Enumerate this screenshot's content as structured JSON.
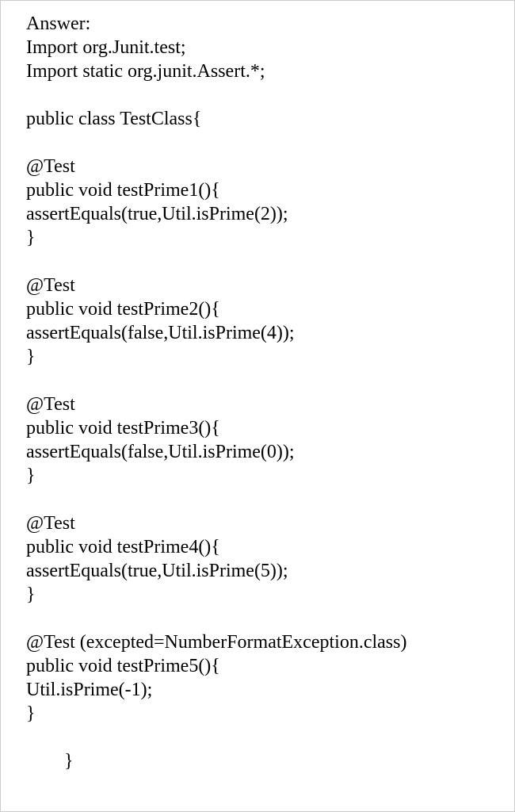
{
  "lines": {
    "l0": "Answer:",
    "l1": "Import org.Junit.test;",
    "l2": "Import static org.junit.Assert.*;",
    "l3": "public class TestClass{",
    "l4": "@Test",
    "l5": "public void testPrime1(){",
    "l6": "assertEquals(true,Util.isPrime(2));",
    "l7": "}",
    "l8": "@Test",
    "l9": "public void testPrime2(){",
    "l10": "assertEquals(false,Util.isPrime(4));",
    "l11": "}",
    "l12": "@Test",
    "l13": "public void testPrime3(){",
    "l14": "assertEquals(false,Util.isPrime(0));",
    "l15": "}",
    "l16": "@Test",
    "l17": "public void testPrime4(){",
    "l18": "assertEquals(true,Util.isPrime(5));",
    "l19": "}",
    "l20": "@Test (excepted=NumberFormatException.class)",
    "l21": "public void testPrime5(){",
    "l22": "Util.isPrime(-1);",
    "l23": "}",
    "l24": "}"
  }
}
